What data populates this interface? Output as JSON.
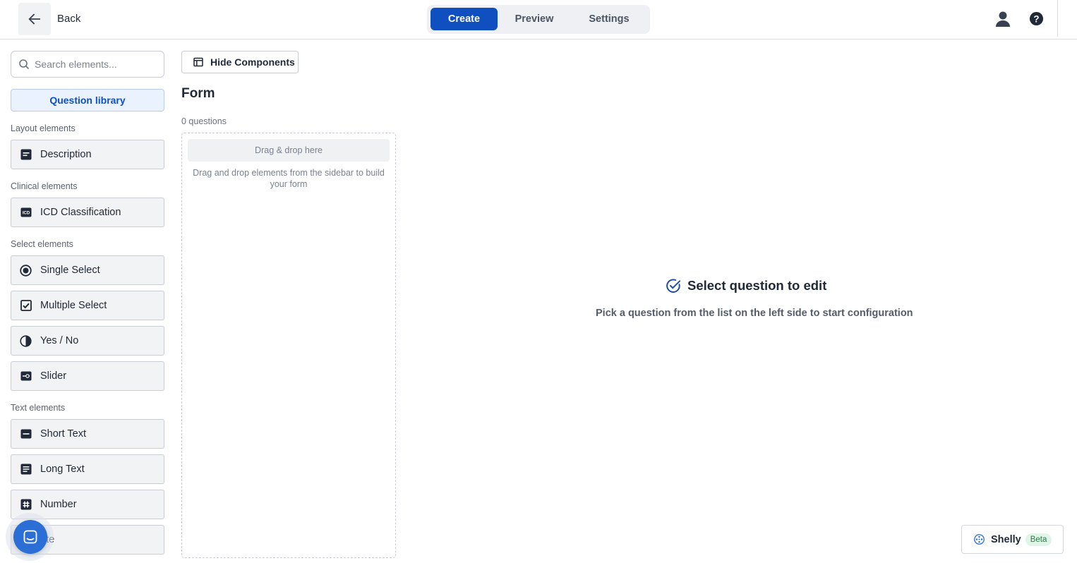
{
  "header": {
    "back_label": "Back",
    "tabs": [
      {
        "label": "Create",
        "active": true
      },
      {
        "label": "Preview",
        "active": false
      },
      {
        "label": "Settings",
        "active": false
      }
    ],
    "icons": [
      "arrow-left-icon",
      "user-icon",
      "help-icon"
    ]
  },
  "sidebar": {
    "search_placeholder": "Search elements...",
    "library_button": "Question library",
    "sections": [
      {
        "label": "Layout elements",
        "items": [
          {
            "label": "Description",
            "icon": "description-icon"
          }
        ]
      },
      {
        "label": "Clinical elements",
        "items": [
          {
            "label": "ICD Classification",
            "icon": "icd-icon"
          }
        ]
      },
      {
        "label": "Select elements",
        "items": [
          {
            "label": "Single Select",
            "icon": "radio-icon"
          },
          {
            "label": "Multiple Select",
            "icon": "checkbox-icon"
          },
          {
            "label": "Yes / No",
            "icon": "half-circle-icon"
          },
          {
            "label": "Slider",
            "icon": "slider-icon"
          }
        ]
      },
      {
        "label": "Text elements",
        "items": [
          {
            "label": "Short Text",
            "icon": "short-text-icon"
          },
          {
            "label": "Long Text",
            "icon": "long-text-icon"
          },
          {
            "label": "Number",
            "icon": "hash-icon"
          },
          {
            "label": "ate",
            "icon": "date-icon"
          }
        ]
      }
    ]
  },
  "form": {
    "hide_components_label": "Hide Components",
    "title": "Form",
    "question_count": "0 questions",
    "drop_label": "Drag & drop here",
    "drop_hint": "Drag and drop elements from the sidebar to build your form"
  },
  "main": {
    "empty_title": "Select question to edit",
    "empty_subtitle": "Pick a question from the list on the left side to start configuration"
  },
  "assistant": {
    "name": "Shelly",
    "badge": "Beta"
  },
  "colors": {
    "primary": "#0f4fbf",
    "library_bg": "#eaf2fe",
    "element_bg": "#f2f3f5",
    "chat_blue": "#2b6fd6",
    "beta_bg": "#dff5e8",
    "beta_text": "#2b7a4b"
  }
}
